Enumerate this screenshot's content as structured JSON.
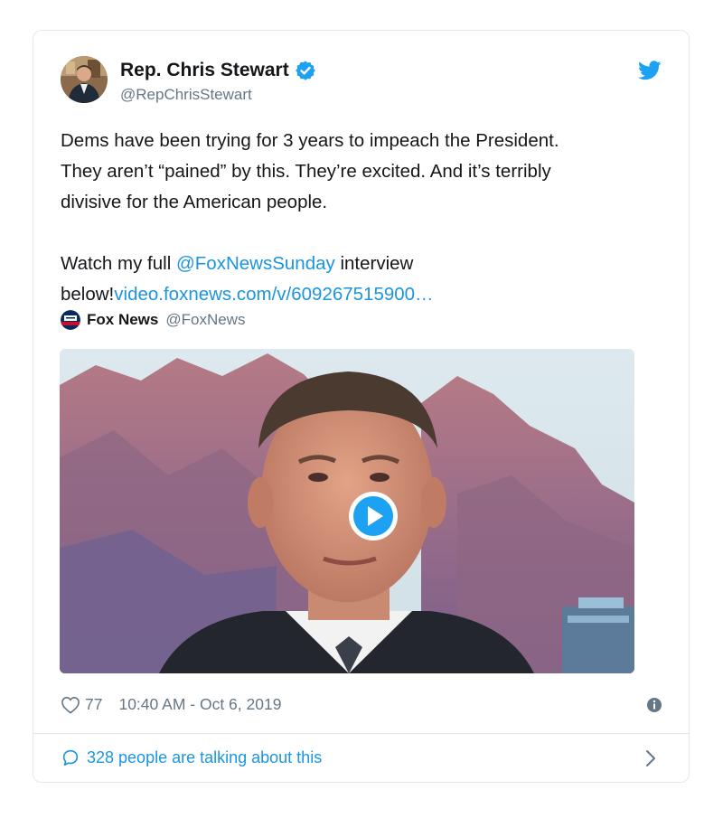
{
  "author": {
    "name": "Rep. Chris Stewart",
    "handle": "@RepChrisStewart",
    "verified_icon": "verified-badge-icon",
    "avatar_icon": "avatar"
  },
  "brand": {
    "icon": "twitter-bird-icon",
    "color": "#1da1f2"
  },
  "tweet": {
    "line1": "Dems have been trying for 3 years to impeach the President.",
    "line2": "They aren’t “pained” by this. They’re excited. And it’s terribly",
    "line3": "divisive for the American people.",
    "watch_prefix": "Watch my full ",
    "mention": "@FoxNewsSunday",
    "watch_mid": " interview",
    "below": "below!",
    "url": "video.foxnews.com/v/609267515900…"
  },
  "quoted": {
    "name": "Fox News",
    "handle": "@FoxNews",
    "logo_icon": "fox-news-logo-icon"
  },
  "media": {
    "type": "video",
    "play_icon": "play-icon"
  },
  "meta": {
    "likes": "77",
    "timestamp": "10:40 AM - Oct 6, 2019",
    "heart_icon": "heart-icon",
    "info_icon": "info-icon"
  },
  "footer": {
    "text": "328 people are talking about this",
    "bubble_icon": "speech-bubble-icon",
    "chevron_icon": "chevron-right-icon"
  },
  "colors": {
    "link": "#1b95e0",
    "text": "#14171a",
    "muted": "#657786",
    "border": "#e1e8ed"
  }
}
